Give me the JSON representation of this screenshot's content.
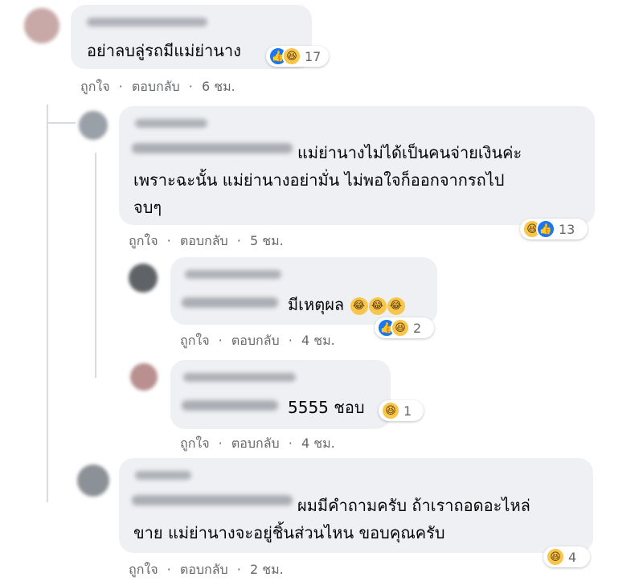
{
  "comments": [
    {
      "text_lines": [
        "อย่าลบลู่รถมีแม่ย่านาง"
      ],
      "reaction_count": "17",
      "reactions": [
        "like",
        "haha"
      ],
      "like_label": "ถูกใจ",
      "reply_label": "ตอบกลับ",
      "time": "6 ชม."
    },
    {
      "text_lines": [
        "แม่ย่านางไม่ได้เป็นคนจ่ายเงินค่ะ",
        "เพราะฉะนั้น แม่ย่านางอย่ามั่น ไม่พอใจก็ออกจากรถไป",
        "จบๆ"
      ],
      "reaction_count": "13",
      "reactions": [
        "haha",
        "like"
      ],
      "like_label": "ถูกใจ",
      "reply_label": "ตอบกลับ",
      "time": "5 ชม."
    },
    {
      "text_lines": [
        "มีเหตุผล"
      ],
      "reaction_count": "2",
      "reactions": [
        "like",
        "haha"
      ],
      "like_label": "ถูกใจ",
      "reply_label": "ตอบกลับ",
      "time": "4 ชม."
    },
    {
      "text_lines": [
        "5555 ชอบ"
      ],
      "reaction_count": "1",
      "reactions": [
        "haha"
      ],
      "like_label": "ถูกใจ",
      "reply_label": "ตอบกลับ",
      "time": "4 ชม."
    },
    {
      "text_lines": [
        "ผมมีคำถามครับ ถ้าเราถอดอะไหล่",
        "ขาย แม่ย่านางจะอยู่ชิ้นส่วนไหน ขอบคุณครับ"
      ],
      "reaction_count": "4",
      "reactions": [
        "haha"
      ],
      "like_label": "ถูกใจ",
      "reply_label": "ตอบกลับ",
      "time": "2 ชม."
    }
  ],
  "separator": "·",
  "icons": {
    "like": "like-icon",
    "haha": "haha-icon"
  }
}
